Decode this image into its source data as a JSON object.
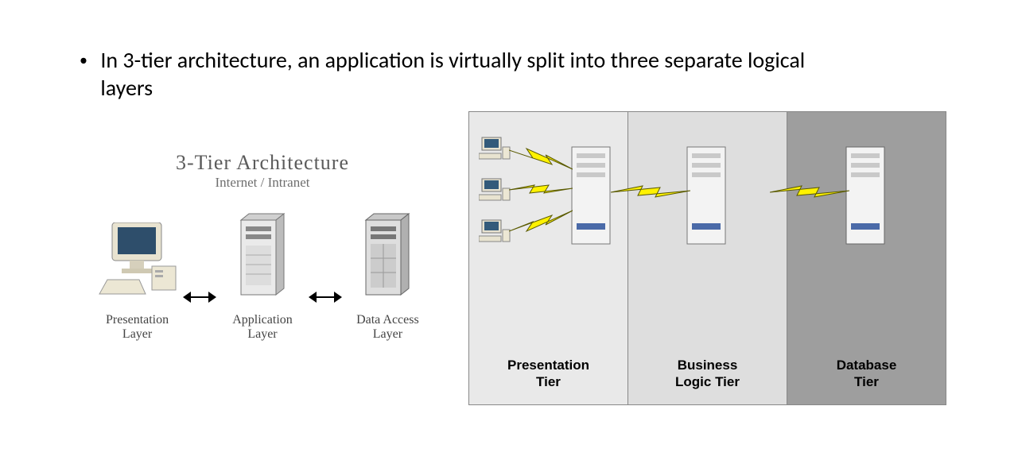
{
  "bullet": "In 3-tier architecture, an application is virtually split into three separate logical layers",
  "left_diagram": {
    "title_line1": "3-Tier Architecture",
    "title_line2": "Internet / Intranet",
    "layers": [
      {
        "label_line1": "Presentation",
        "label_line2": "Layer"
      },
      {
        "label_line1": "Application",
        "label_line2": "Layer"
      },
      {
        "label_line1": "Data Access",
        "label_line2": "Layer"
      }
    ]
  },
  "right_diagram": {
    "tiers": [
      {
        "label_line1": "Presentation",
        "label_line2": "Tier"
      },
      {
        "label_line1": "Business",
        "label_line2": "Logic Tier"
      },
      {
        "label_line1": "Database",
        "label_line2": "Tier"
      }
    ]
  }
}
